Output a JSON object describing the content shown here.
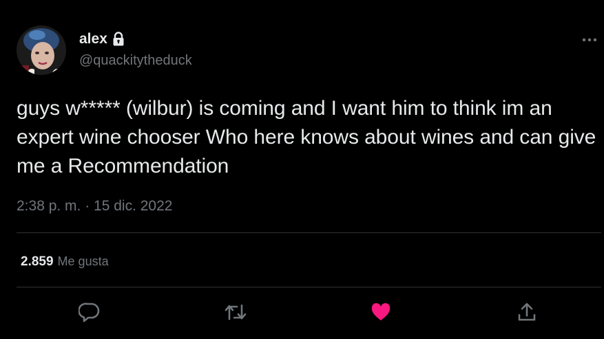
{
  "author": {
    "display_name": "alex",
    "handle": "@quackitytheduck",
    "avatar_icon": "avatar",
    "protected_icon": "lock-icon"
  },
  "tweet": {
    "text": "guys w***** (wilbur) is coming and I want him to think im an expert wine chooser Who here knows about wines and can give me a Recommendation",
    "timestamp": "2:38 p. m. · 15 dic. 2022"
  },
  "stats": {
    "likes_count": "2.859",
    "likes_label": "Me gusta"
  },
  "actions": {
    "reply_icon": "reply-icon",
    "retweet_icon": "retweet-icon",
    "like_icon": "heart-icon",
    "share_icon": "share-icon",
    "more_icon": "more-icon"
  },
  "colors": {
    "background": "#000000",
    "text_primary": "#e7e9ea",
    "text_secondary": "#71767b",
    "divider": "#2f3336",
    "like_active": "#f91880"
  }
}
